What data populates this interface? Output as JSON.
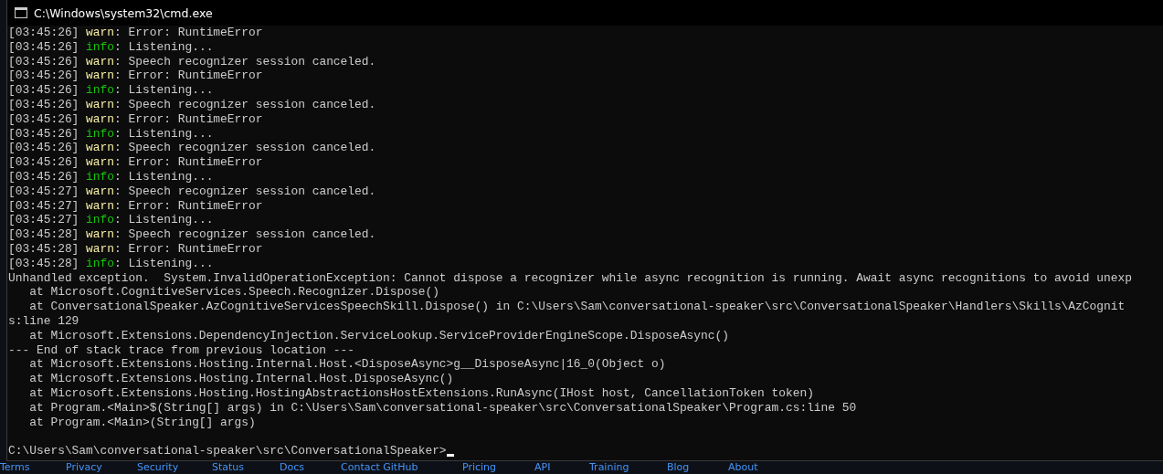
{
  "window": {
    "title": "C:\\Windows\\system32\\cmd.exe"
  },
  "console": {
    "lines": [
      {
        "kind": "log",
        "time": "[03:45:26]",
        "level": "warn",
        "message": ": Error: RuntimeError"
      },
      {
        "kind": "log",
        "time": "[03:45:26]",
        "level": "info",
        "message": ": Listening..."
      },
      {
        "kind": "log",
        "time": "[03:45:26]",
        "level": "warn",
        "message": ": Speech recognizer session canceled."
      },
      {
        "kind": "log",
        "time": "[03:45:26]",
        "level": "warn",
        "message": ": Error: RuntimeError"
      },
      {
        "kind": "log",
        "time": "[03:45:26]",
        "level": "info",
        "message": ": Listening..."
      },
      {
        "kind": "log",
        "time": "[03:45:26]",
        "level": "warn",
        "message": ": Speech recognizer session canceled."
      },
      {
        "kind": "log",
        "time": "[03:45:26]",
        "level": "warn",
        "message": ": Error: RuntimeError"
      },
      {
        "kind": "log",
        "time": "[03:45:26]",
        "level": "info",
        "message": ": Listening..."
      },
      {
        "kind": "log",
        "time": "[03:45:26]",
        "level": "warn",
        "message": ": Speech recognizer session canceled."
      },
      {
        "kind": "log",
        "time": "[03:45:26]",
        "level": "warn",
        "message": ": Error: RuntimeError"
      },
      {
        "kind": "log",
        "time": "[03:45:26]",
        "level": "info",
        "message": ": Listening..."
      },
      {
        "kind": "log",
        "time": "[03:45:27]",
        "level": "warn",
        "message": ": Speech recognizer session canceled."
      },
      {
        "kind": "log",
        "time": "[03:45:27]",
        "level": "warn",
        "message": ": Error: RuntimeError"
      },
      {
        "kind": "log",
        "time": "[03:45:27]",
        "level": "info",
        "message": ": Listening..."
      },
      {
        "kind": "log",
        "time": "[03:45:28]",
        "level": "warn",
        "message": ": Speech recognizer session canceled."
      },
      {
        "kind": "log",
        "time": "[03:45:28]",
        "level": "warn",
        "message": ": Error: RuntimeError"
      },
      {
        "kind": "log",
        "time": "[03:45:28]",
        "level": "info",
        "message": ": Listening..."
      },
      {
        "kind": "text",
        "text": "Unhandled exception.  System.InvalidOperationException: Cannot dispose a recognizer while async recognition is running. Await async recognitions to avoid unexp"
      },
      {
        "kind": "text",
        "text": "   at Microsoft.CognitiveServices.Speech.Recognizer.Dispose()"
      },
      {
        "kind": "text",
        "text": "   at ConversationalSpeaker.AzCognitiveServicesSpeechSkill.Dispose() in C:\\Users\\Sam\\conversational-speaker\\src\\ConversationalSpeaker\\Handlers\\Skills\\AzCognit"
      },
      {
        "kind": "text",
        "text": "s:line 129"
      },
      {
        "kind": "text",
        "text": "   at Microsoft.Extensions.DependencyInjection.ServiceLookup.ServiceProviderEngineScope.DisposeAsync()"
      },
      {
        "kind": "text",
        "text": "--- End of stack trace from previous location ---"
      },
      {
        "kind": "text",
        "text": "   at Microsoft.Extensions.Hosting.Internal.Host.<DisposeAsync>g__DisposeAsync|16_0(Object o)"
      },
      {
        "kind": "text",
        "text": "   at Microsoft.Extensions.Hosting.Internal.Host.DisposeAsync()"
      },
      {
        "kind": "text",
        "text": "   at Microsoft.Extensions.Hosting.HostingAbstractionsHostExtensions.RunAsync(IHost host, CancellationToken token)"
      },
      {
        "kind": "text",
        "text": "   at Program.<Main>$(String[] args) in C:\\Users\\Sam\\conversational-speaker\\src\\ConversationalSpeaker\\Program.cs:line 50"
      },
      {
        "kind": "text",
        "text": "   at Program.<Main>(String[] args)"
      },
      {
        "kind": "blank"
      },
      {
        "kind": "prompt",
        "text": "C:\\Users\\Sam\\conversational-speaker\\src\\ConversationalSpeaker>"
      }
    ]
  },
  "footer": {
    "links": [
      "Terms",
      "Privacy",
      "Security",
      "Status",
      "Docs",
      "Contact GitHub",
      "Pricing",
      "API",
      "Training",
      "Blog",
      "About"
    ]
  }
}
